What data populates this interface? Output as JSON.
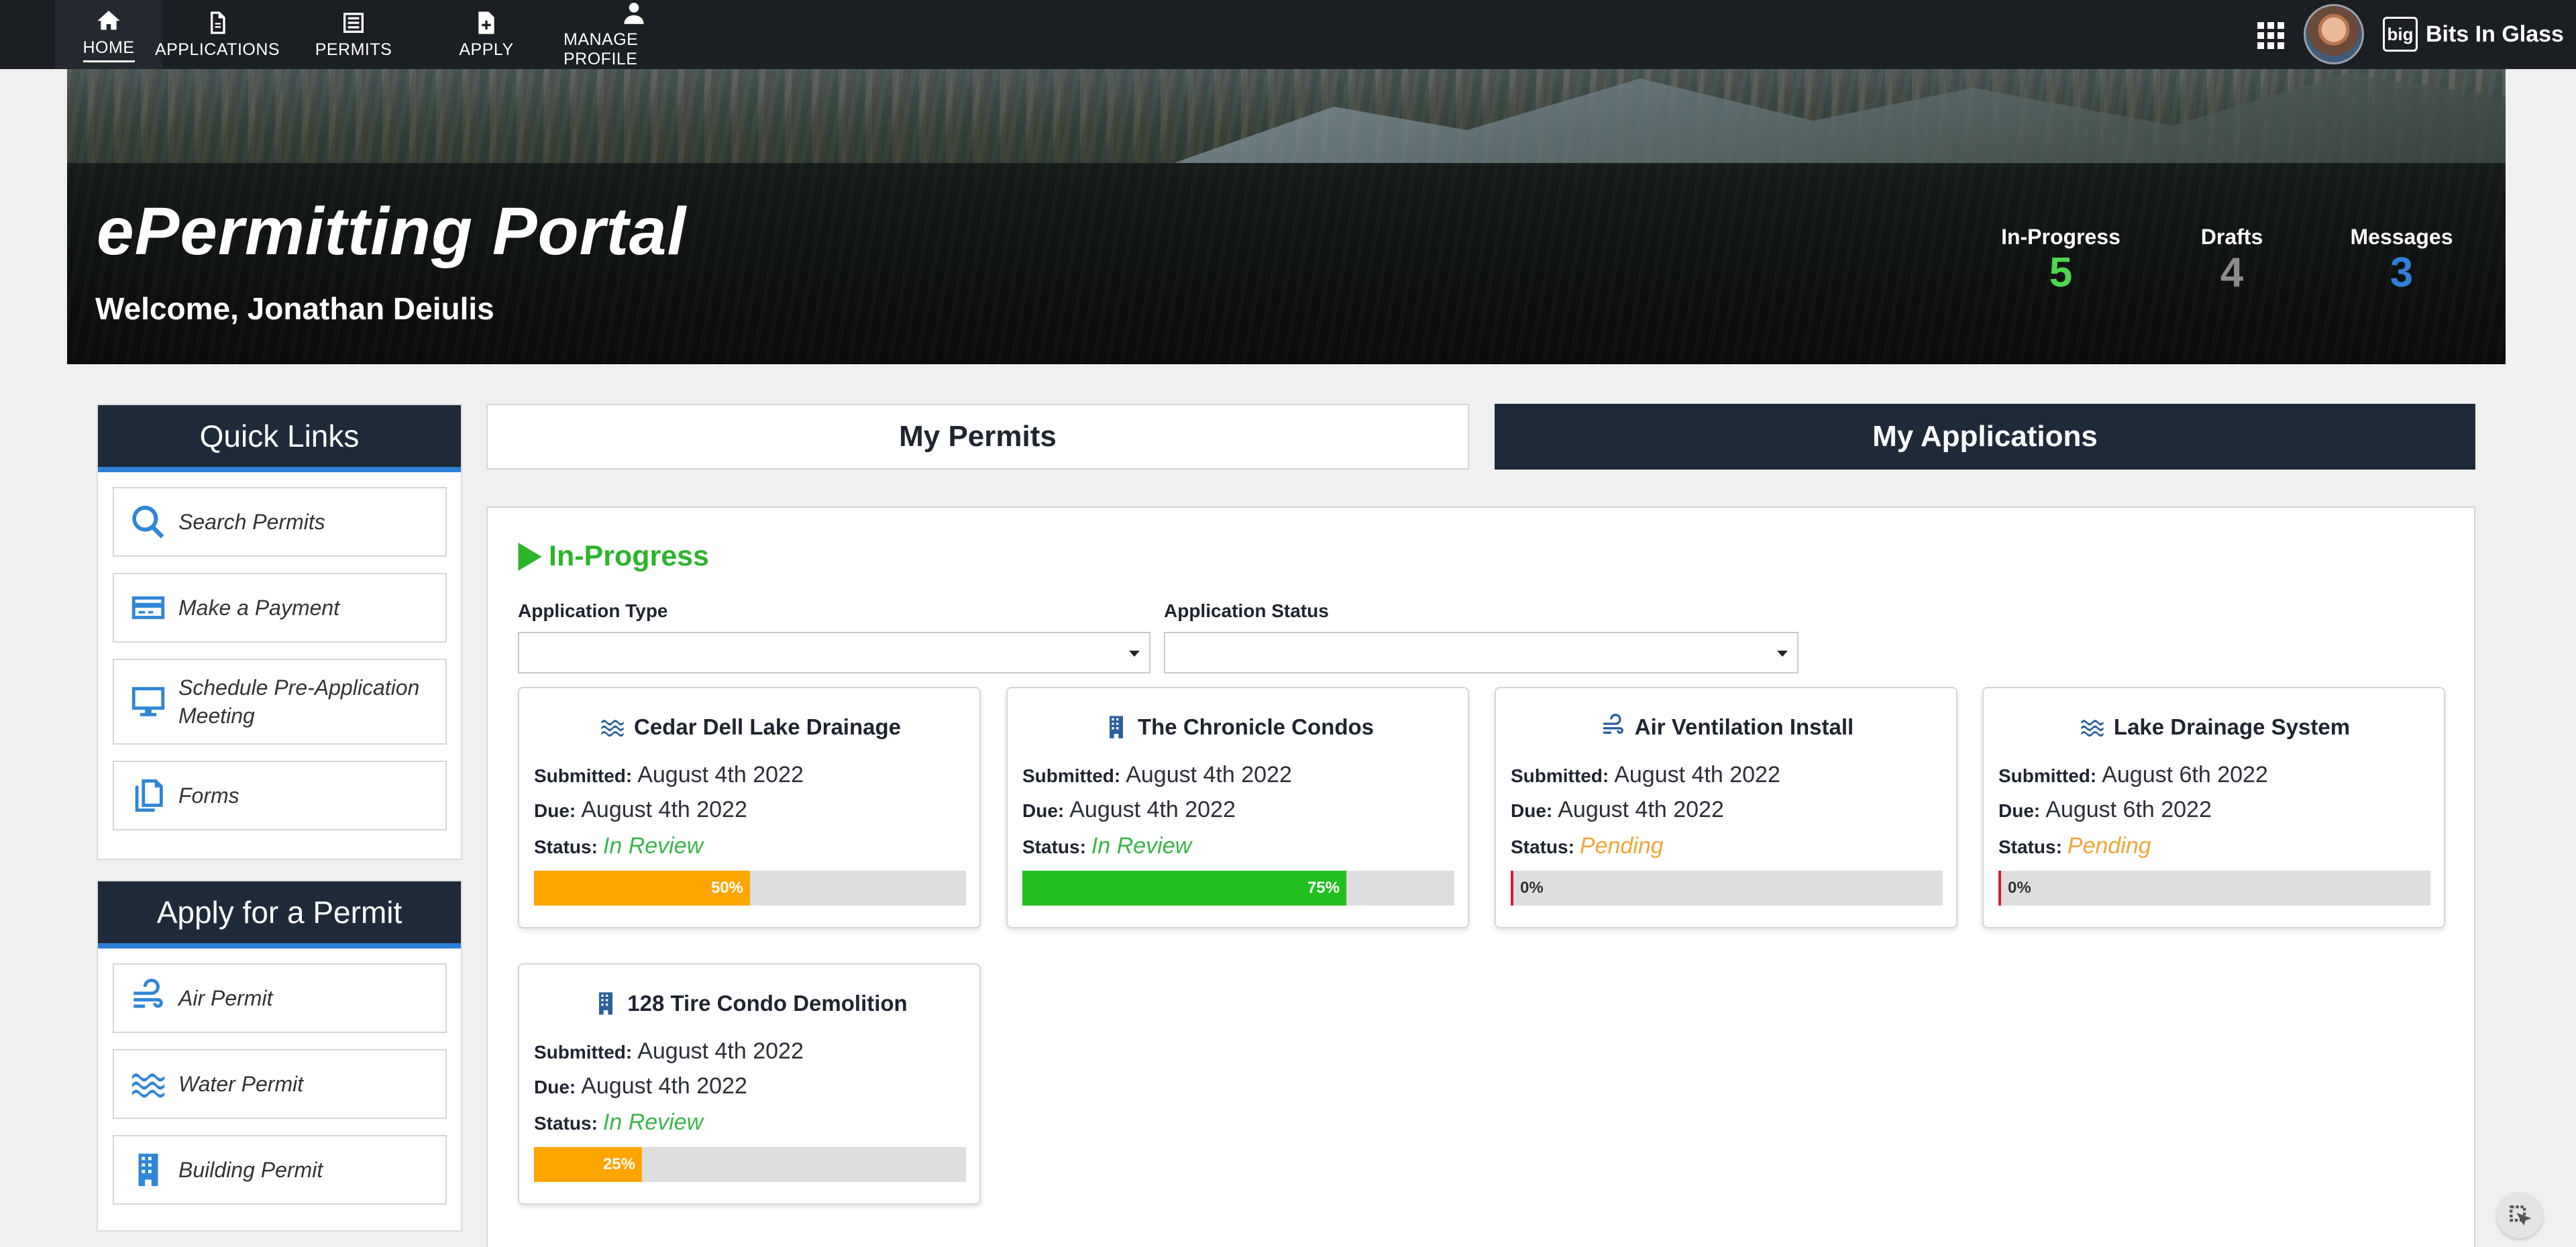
{
  "nav": {
    "items": [
      {
        "label": "HOME",
        "icon": "home-icon"
      },
      {
        "label": "APPLICATIONS",
        "icon": "document-icon"
      },
      {
        "label": "PERMITS",
        "icon": "list-icon"
      },
      {
        "label": "APPLY",
        "icon": "file-plus-icon"
      },
      {
        "label": "MANAGE PROFILE",
        "icon": "user-icon"
      }
    ],
    "active": "HOME",
    "brand_logo": "big",
    "brand_name": "Bits In Glass"
  },
  "hero": {
    "title": "ePermitting Portal",
    "welcome": "Welcome, Jonathan Deiulis",
    "stats": [
      {
        "label": "In-Progress",
        "value": "5",
        "color": "#4cd94c"
      },
      {
        "label": "Drafts",
        "value": "4",
        "color": "#8c8c8c"
      },
      {
        "label": "Messages",
        "value": "3",
        "color": "#2f7fd6"
      }
    ]
  },
  "quick_links": {
    "title": "Quick Links",
    "items": [
      {
        "label": "Search Permits",
        "icon": "search-icon"
      },
      {
        "label": "Make a Payment",
        "icon": "credit-card-icon"
      },
      {
        "label": "Schedule Pre-Application Meeting",
        "icon": "monitor-icon"
      },
      {
        "label": "Forms",
        "icon": "copy-icon"
      }
    ]
  },
  "apply_permit": {
    "title": "Apply for a Permit",
    "items": [
      {
        "label": "Air Permit",
        "icon": "wind-icon"
      },
      {
        "label": "Water Permit",
        "icon": "water-icon"
      },
      {
        "label": "Building Permit",
        "icon": "building-icon"
      }
    ]
  },
  "tabs": {
    "my_permits": "My Permits",
    "my_applications": "My Applications",
    "active": "My Applications"
  },
  "main": {
    "section_title": "In-Progress",
    "filters": {
      "application_type_label": "Application Type",
      "application_status_label": "Application Status",
      "application_type_value": "",
      "application_status_value": ""
    },
    "submitted_label": "Submitted:",
    "due_label": "Due:",
    "status_label": "Status:",
    "cards": [
      {
        "title": "Cedar Dell Lake Drainage",
        "icon": "water-icon",
        "submitted": "August 4th 2022",
        "due": "August 4th 2022",
        "status": "In Review",
        "progress": 50,
        "progress_label": "50%",
        "bar_color": "#ffa500"
      },
      {
        "title": "The Chronicle Condos",
        "icon": "building-icon",
        "submitted": "August 4th 2022",
        "due": "August 4th 2022",
        "status": "In Review",
        "progress": 75,
        "progress_label": "75%",
        "bar_color": "#22c01f"
      },
      {
        "title": "Air Ventilation Install",
        "icon": "wind-icon",
        "submitted": "August 4th 2022",
        "due": "August 4th 2022",
        "status": "Pending",
        "progress": 0,
        "progress_label": "0%",
        "bar_color": "#d41f2e"
      },
      {
        "title": "Lake Drainage System",
        "icon": "water-icon",
        "submitted": "August 6th 2022",
        "due": "August 6th 2022",
        "status": "Pending",
        "progress": 0,
        "progress_label": "0%",
        "bar_color": "#d41f2e"
      },
      {
        "title": "128 Tire Condo Demolition",
        "icon": "building-icon",
        "submitted": "August 4th 2022",
        "due": "August 4th 2022",
        "status": "In Review",
        "progress": 25,
        "progress_label": "25%",
        "bar_color": "#ffa500"
      }
    ]
  }
}
